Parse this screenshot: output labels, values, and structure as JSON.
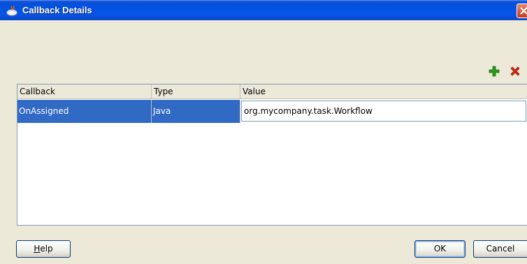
{
  "window": {
    "title": "Callback Details"
  },
  "toolbar": {
    "add_icon": "add-plus-icon",
    "delete_icon": "delete-x-icon"
  },
  "table": {
    "columns": [
      "Callback",
      "Type",
      "Value"
    ],
    "rows": [
      {
        "callback": "OnAssigned",
        "type": "Java",
        "value": "org.mycompany.task.Workflow"
      }
    ]
  },
  "buttons": {
    "help": "Help",
    "ok": "OK",
    "cancel": "Cancel"
  },
  "colors": {
    "titlebar": "#0053e3",
    "selection": "#316ac5",
    "add": "#2a9a1a",
    "delete": "#d42a12"
  }
}
